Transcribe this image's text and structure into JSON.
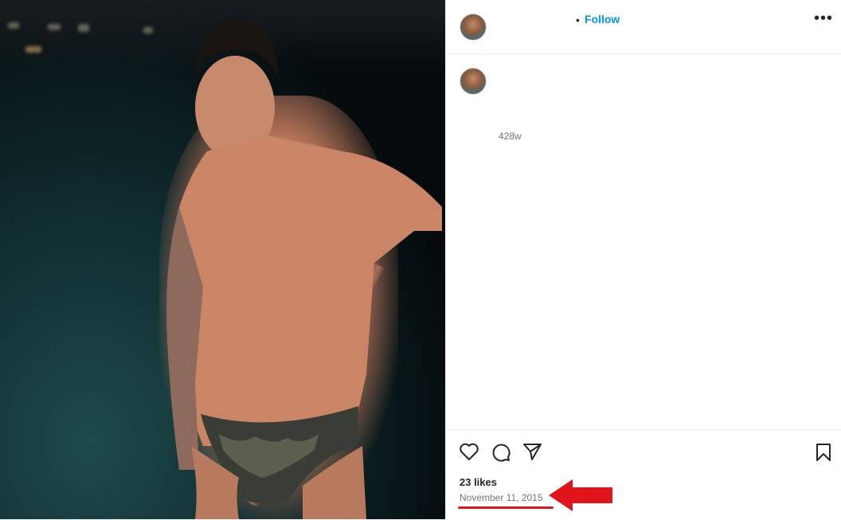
{
  "header": {
    "follow_label": "Follow",
    "separator": "•",
    "more_label": "•••"
  },
  "caption": {
    "time_ago": "428w"
  },
  "actions": {
    "icons": [
      "heart-icon",
      "comment-icon",
      "share-icon",
      "bookmark-icon"
    ]
  },
  "stats": {
    "likes": "23 likes",
    "date": "November 11, 2015"
  },
  "colors": {
    "follow": "#0095f6",
    "annotation": "#e0141b"
  }
}
